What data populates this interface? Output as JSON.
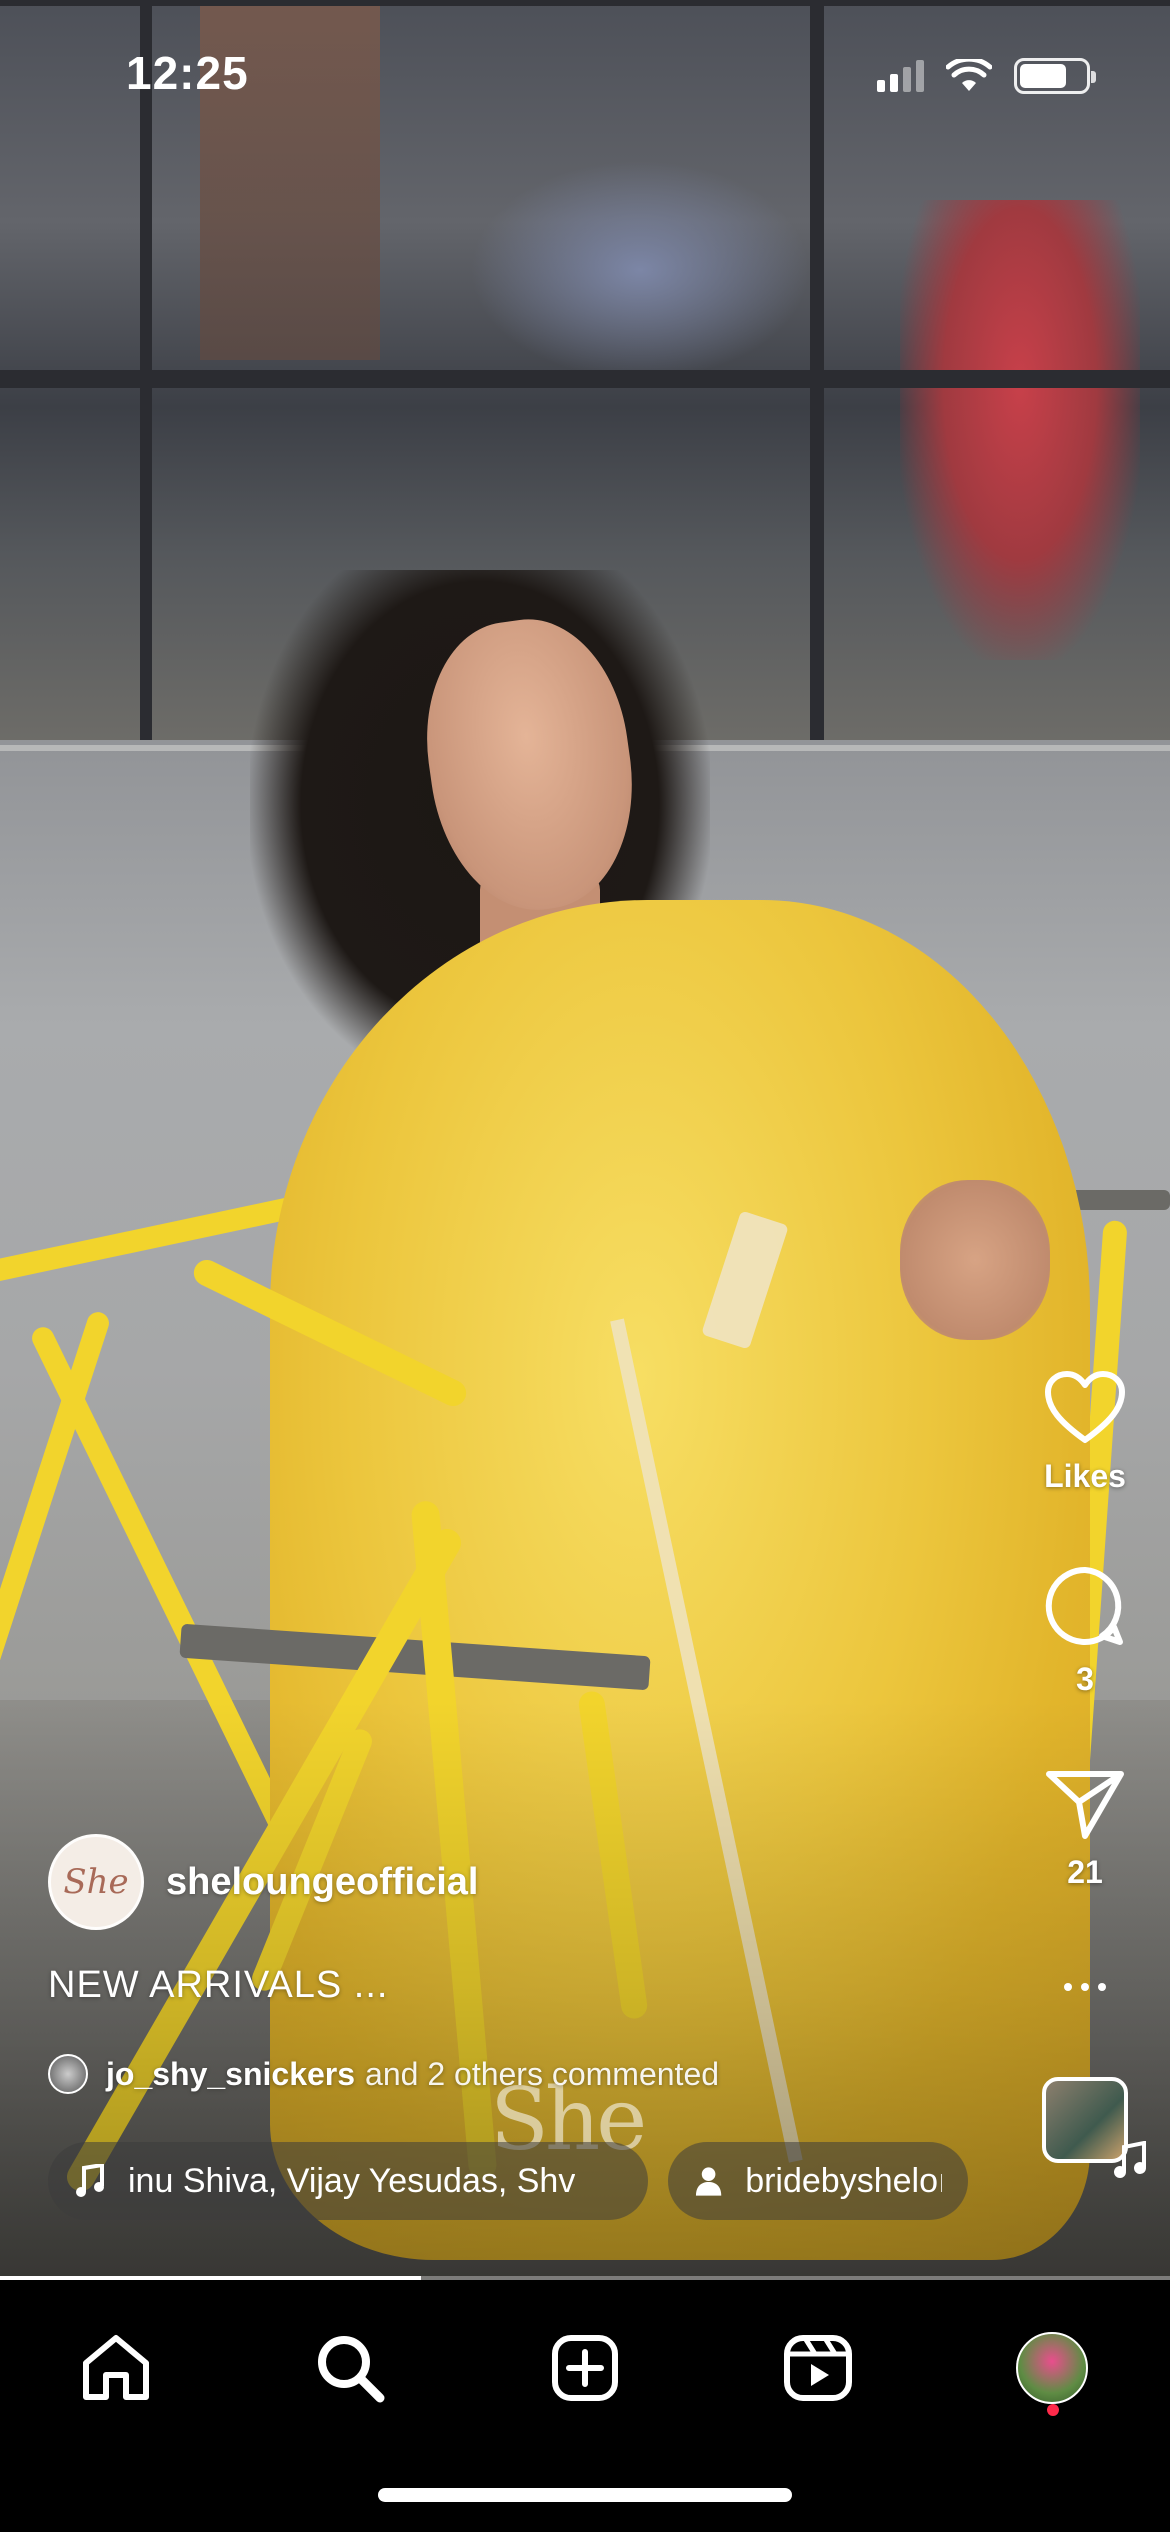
{
  "status_bar": {
    "time": "12:25",
    "icons": [
      "cellular-signal-icon",
      "wifi-icon",
      "battery-icon"
    ]
  },
  "reel": {
    "watermark": "She",
    "author": {
      "avatar_text": "She",
      "username": "sheloungeofficial"
    },
    "caption": "NEW ARRIVALS ...",
    "comments": {
      "user": "jo_shy_snickers",
      "rest": "and 2 others commented"
    },
    "audio": {
      "icon": "music-note-icon",
      "label": "inu Shiva, Vijay Yesudas, Shv"
    },
    "tagged": {
      "icon": "person-icon",
      "label": "bridebysheloı"
    },
    "actions": {
      "likes_label": "Likes",
      "comments_count": "3",
      "shares_count": "21"
    },
    "progress": 0.36
  },
  "tab_bar": {
    "items": [
      "home-icon",
      "search-icon",
      "create-icon",
      "reels-icon",
      "profile-avatar"
    ],
    "active": "search-icon"
  },
  "colors": {
    "accent_dot": "#ff2a4a",
    "dress_yellow": "#ecc63d",
    "chair_yellow": "#f2d42c"
  }
}
